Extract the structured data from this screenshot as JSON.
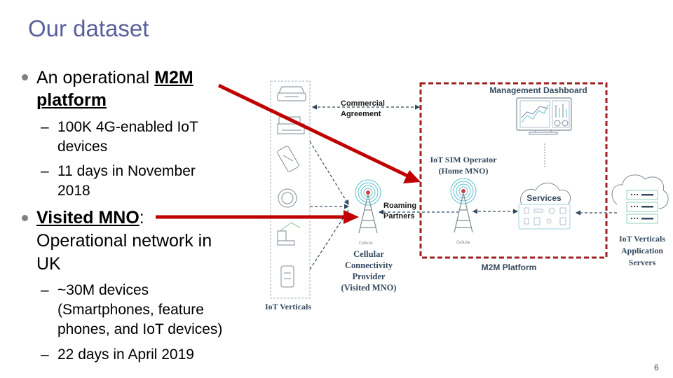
{
  "slide": {
    "title": "Our dataset",
    "page_number": "6"
  },
  "bullets": [
    {
      "prefix": "An operational ",
      "emphasis_line1": "M2M",
      "emphasis_line2": "platform",
      "sub_items": [
        {
          "dash": "–",
          "lines": [
            "100K 4G-enabled IoT",
            "devices"
          ]
        },
        {
          "dash": "–",
          "lines": [
            "11 days in November",
            "2018"
          ]
        }
      ]
    },
    {
      "emphasis": "Visited MNO",
      "suffix": ":",
      "line2": "Operational network in",
      "line3": "UK",
      "sub_items": [
        {
          "dash": "–",
          "lines": [
            "~30M devices",
            "(Smartphones, feature",
            "phones, and IoT devices)"
          ]
        },
        {
          "dash": "–",
          "lines": [
            "22 days in April 2019"
          ]
        }
      ]
    }
  ],
  "diagram": {
    "iot_verticals_label": "IoT Verticals",
    "commercial_agreement": [
      "Commercial",
      "Agreement"
    ],
    "roaming_partners": [
      "Roaming",
      "Partners"
    ],
    "visited_mno_label": [
      "Cellular",
      "Connectivity",
      "Provider",
      "(Visited MNO)"
    ],
    "cellular_caption": "Cellular",
    "m2m_platform_label": "M2M Platform",
    "management_dashboard": "Management Dashboard",
    "home_mno_label": [
      "IoT SIM Operator",
      "(Home MNO)"
    ],
    "services_label": "Services",
    "app_servers_label": [
      "IoT Verticals",
      "Application",
      "Servers"
    ],
    "colors": {
      "title": "#5a5f9c",
      "highlight_arrow": "#c00000",
      "platform_border": "#a02020",
      "dark_blue_text": "#34495e",
      "dashed_line": "#34495e",
      "teal": "#5bbfcc"
    }
  }
}
